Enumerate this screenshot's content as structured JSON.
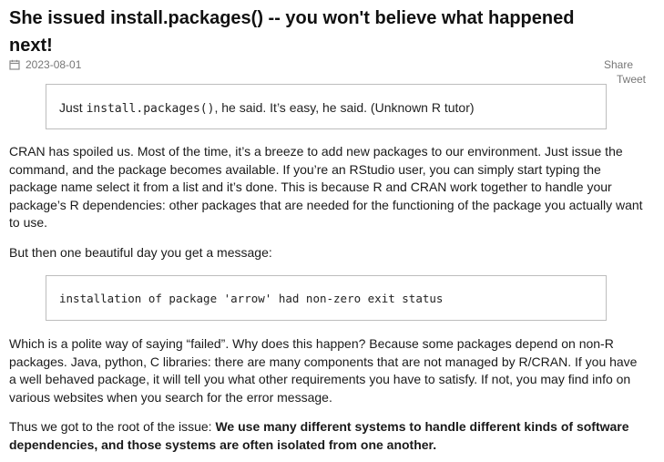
{
  "post": {
    "title": "She issued install.packages() -- you won't believe what happened next!",
    "date": "2023-08-01",
    "share_label": "Share",
    "tweet_label": "Tweet"
  },
  "quote": {
    "prefix": "Just ",
    "code": "install.packages()",
    "suffix": ", he said. It’s easy, he said. (Unknown R tutor)"
  },
  "paragraphs": {
    "p1": "CRAN has spoiled us. Most of the time, it’s a breeze to add new packages to our environment. Just issue the command, and the package becomes available. If you’re an RStudio user, you can simply start typing the package name select it from a list and it’s done. This is because R and CRAN work together to handle your package’s R dependencies: other packages that are needed for the functioning of the package you actually want to use.",
    "p2": "But then one beautiful day you get a message:",
    "p3": "Which is a polite way of saying “failed”. Why does this happen? Because some packages depend on non-R packages. Java, python, C libraries: there are many components that are not managed by R/CRAN. If you have a well behaved package, it will tell you what other requirements you have to satisfy. If not, you may find info on various websites when you search for the error message.",
    "p4_prefix": "Thus we got to the root of the issue: ",
    "p4_bold": "We use many different systems to handle different kinds of software dependencies, and those systems are often isolated from one another."
  },
  "code_block": {
    "text": "installation of package 'arrow' had non-zero exit status"
  },
  "icons": {
    "date_icon": "calendar-icon"
  }
}
